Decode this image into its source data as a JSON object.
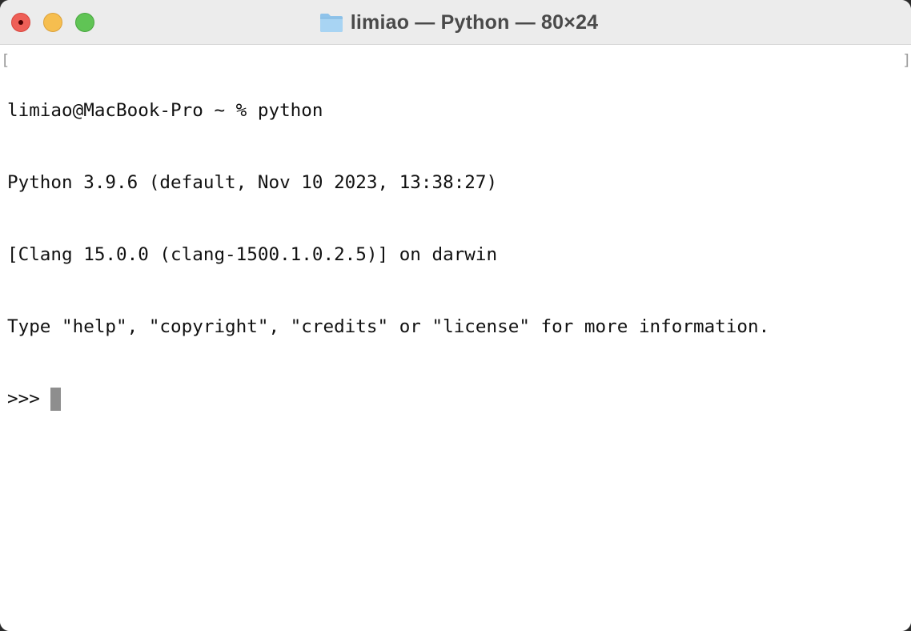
{
  "window": {
    "title": "limiao — Python — 80×24",
    "title_icon": "folder-icon",
    "controls": [
      "close",
      "minimize",
      "zoom"
    ]
  },
  "terminal": {
    "lines": [
      "limiao@MacBook-Pro ~ % python",
      "Python 3.9.6 (default, Nov 10 2023, 13:38:27)",
      "[Clang 15.0.0 (clang-1500.1.0.2.5)] on darwin",
      "Type \"help\", \"copyright\", \"credits\" or \"license\" for more information."
    ],
    "prompt": ">>> ",
    "mark_left": "[",
    "mark_right": "]"
  },
  "colors": {
    "close": "#ee5f57",
    "minimize": "#f6be4f",
    "zoom": "#60c455",
    "cursor": "#8e8e8e"
  }
}
